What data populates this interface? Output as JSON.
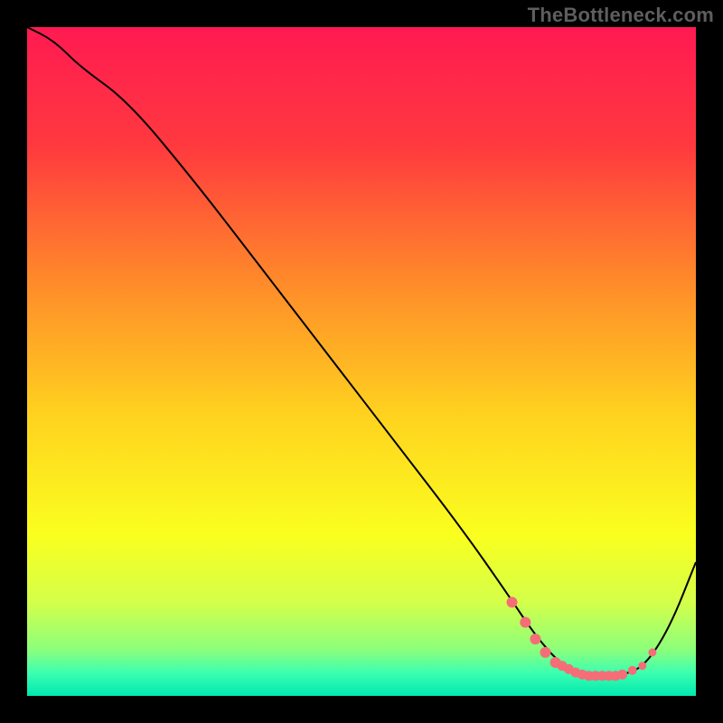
{
  "watermark": "TheBottleneck.com",
  "chart_data": {
    "type": "line",
    "title": "",
    "xlabel": "",
    "ylabel": "",
    "xlim": [
      0,
      100
    ],
    "ylim": [
      0,
      100
    ],
    "series": [
      {
        "name": "curve",
        "x": [
          0,
          4,
          8,
          15,
          25,
          35,
          45,
          55,
          65,
          72,
          76,
          80,
          84,
          88,
          92,
          96,
          100
        ],
        "y": [
          100,
          98,
          94,
          89,
          77,
          64,
          51,
          38,
          25,
          15,
          9,
          4.5,
          3,
          3,
          4,
          10,
          20
        ]
      }
    ],
    "markers": {
      "name": "highlight",
      "color": "#f56d77",
      "x": [
        72.5,
        74.5,
        76,
        77.5,
        79,
        80,
        81,
        82,
        83,
        84,
        85,
        86,
        87,
        88,
        89,
        90.5,
        92,
        93.5
      ],
      "y": [
        14,
        11,
        8.5,
        6.5,
        5,
        4.5,
        4,
        3.5,
        3.2,
        3,
        3,
        3,
        3,
        3,
        3.2,
        3.8,
        4.5,
        6.5
      ],
      "r": [
        6,
        6,
        6,
        6,
        6,
        5.5,
        5.5,
        5.5,
        5.5,
        5.5,
        5.5,
        5.5,
        5.5,
        5.5,
        5.5,
        5,
        4.5,
        4.5
      ]
    },
    "gradient_stops": [
      {
        "offset": 0.0,
        "color": "#ff1a52"
      },
      {
        "offset": 0.18,
        "color": "#ff3a3e"
      },
      {
        "offset": 0.38,
        "color": "#ff8a2a"
      },
      {
        "offset": 0.58,
        "color": "#ffd21f"
      },
      {
        "offset": 0.76,
        "color": "#faff1f"
      },
      {
        "offset": 0.86,
        "color": "#d4ff4a"
      },
      {
        "offset": 0.93,
        "color": "#8dff7a"
      },
      {
        "offset": 0.965,
        "color": "#3dffb0"
      },
      {
        "offset": 1.0,
        "color": "#00e8b0"
      }
    ]
  }
}
